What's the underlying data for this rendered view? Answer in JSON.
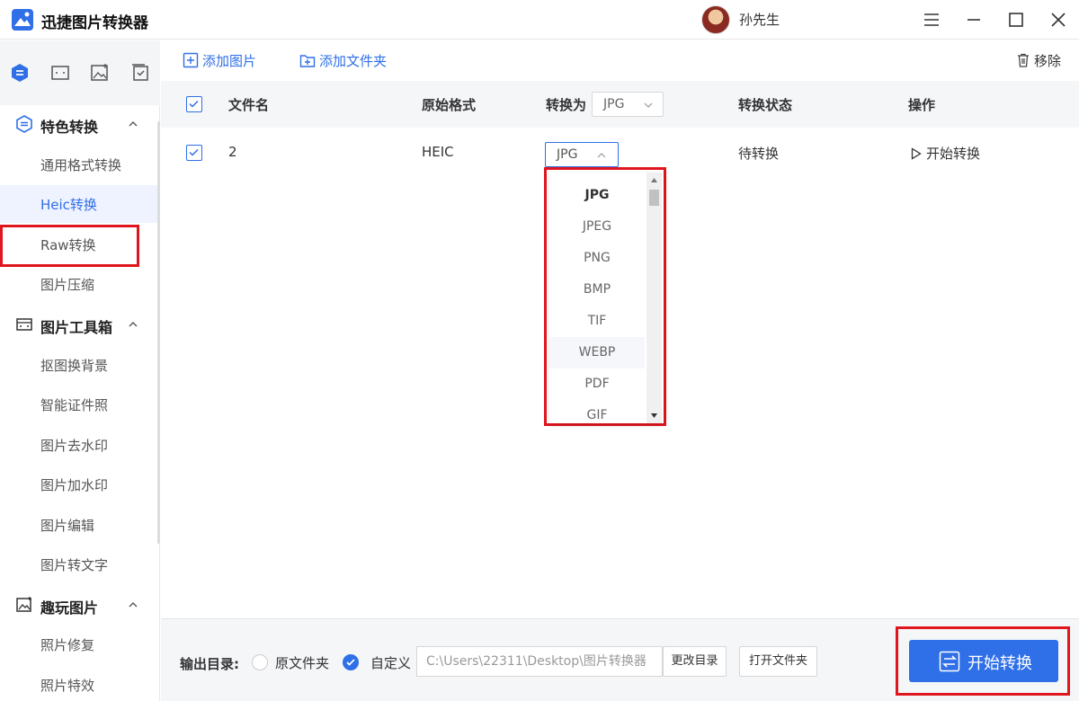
{
  "app": {
    "title": "迅捷图片转换器",
    "user": "孙先生"
  },
  "sidebar": {
    "sections": [
      {
        "label": "特色转换",
        "items": [
          "通用格式转换",
          "Heic转换",
          "Raw转换",
          "图片压缩"
        ]
      },
      {
        "label": "图片工具箱",
        "items": [
          "抠图换背景",
          "智能证件照",
          "图片去水印",
          "图片加水印",
          "图片编辑",
          "图片转文字"
        ]
      },
      {
        "label": "趣玩图片",
        "items": [
          "照片修复",
          "照片特效"
        ]
      }
    ],
    "active_item": "Heic转换"
  },
  "toolbar": {
    "add_image": "添加图片",
    "add_folder": "添加文件夹",
    "remove": "移除"
  },
  "table": {
    "headers": {
      "filename": "文件名",
      "original_format": "原始格式",
      "convert_to": "转换为",
      "status": "转换状态",
      "action": "操作"
    },
    "header_format": "JPG",
    "rows": [
      {
        "filename": "2",
        "original_format": "HEIC",
        "target": "JPG",
        "status": "待转换",
        "action": "开始转换"
      }
    ]
  },
  "dropdown": {
    "options": [
      "JPG",
      "JPEG",
      "PNG",
      "BMP",
      "TIF",
      "WEBP",
      "PDF",
      "GIF"
    ],
    "selected": "JPG",
    "hovered": "WEBP"
  },
  "bottom": {
    "output_label": "输出目录:",
    "radio_original": "原文件夹",
    "radio_custom": "自定义",
    "path": "C:\\Users\\22311\\Desktop\\图片转换器",
    "change_dir": "更改目录",
    "open_folder": "打开文件夹",
    "start": "开始转换"
  },
  "colors": {
    "accent": "#2f6fe8",
    "highlight": "#e0161e"
  }
}
